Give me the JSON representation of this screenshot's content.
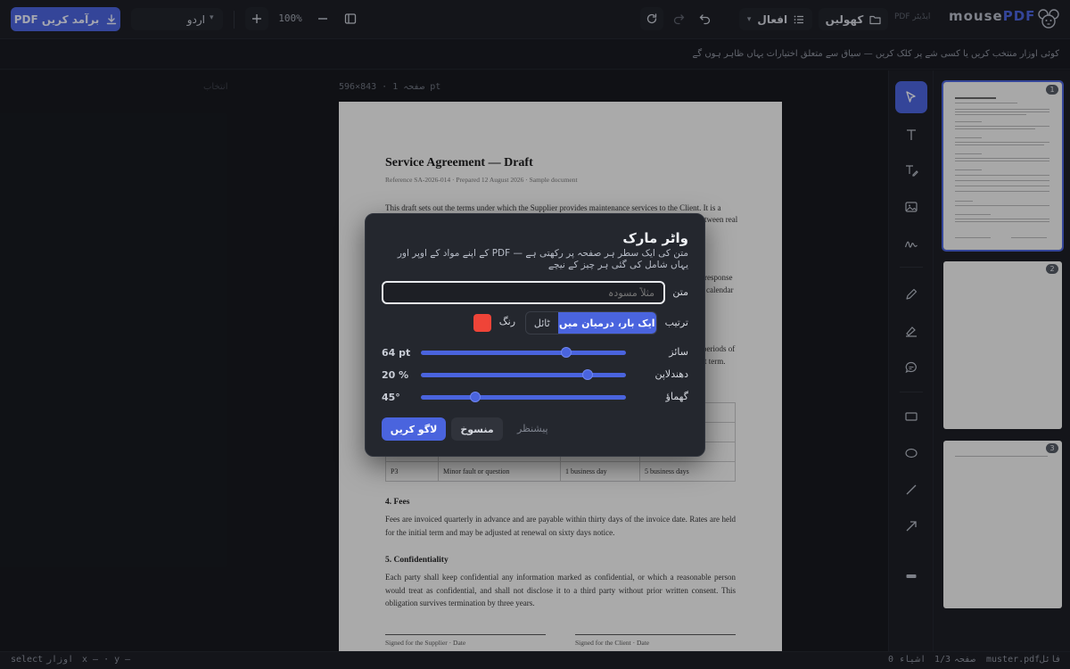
{
  "toolbar": {
    "export_label": "PDF برآمد کریں",
    "language": "اردو",
    "zoom": "100%",
    "actions_label": "افعال",
    "open_label": "کھولیں",
    "version": "PDF ایڈیٹر",
    "brand_a": "mouse",
    "brand_b": "PDF"
  },
  "hint": "کوئی اوزار منتخب کریں یا کسی شے پر کلک کریں — سیاق سے متعلق اختیارات یہاں ظاہر ہوں گے",
  "canvas": {
    "filename_dim": "انتخاب",
    "page_info": "صفحہ 1 · 843×596 pt"
  },
  "document": {
    "title": "Service Agreement — Draft",
    "reference": "Reference SA-2026-014 · Prepared 12 August 2026 · Sample document",
    "intro": "This draft sets out the terms under which the Supplier provides maintenance services to the Client. It is a",
    "intro_tail": "tween real",
    "frag_response": "response",
    "frag_calendar": "calendar",
    "frag_periods": "periods of",
    "frag_term": "t term.",
    "sla_last_row": [
      "P3",
      "Minor fault or question",
      "1 business day",
      "5 business days"
    ],
    "fees_heading": "4. Fees",
    "fees_text": "Fees are invoiced quarterly in advance and are payable within thirty days of the invoice date. Rates are held for the initial term and may be adjusted at renewal on sixty days notice.",
    "conf_heading": "5. Confidentiality",
    "conf_text": "Each party shall keep confidential any information marked as confidential, or which a reasonable person would treat as confidential, and shall not disclose it to a third party without prior written consent. This obligation survives termination by three years.",
    "sign_supplier": "Signed for the Supplier · Date",
    "sign_client": "Signed for the Client · Date"
  },
  "thumbnails": [
    {
      "page": "1",
      "selected": true
    },
    {
      "page": "2",
      "selected": false
    },
    {
      "page": "3",
      "selected": false
    }
  ],
  "status": {
    "file_label": "فائل",
    "file": "muster.pdf",
    "page_label": "صفحہ",
    "page": "1/3",
    "objects_label": "اشیاء",
    "objects": "0",
    "tool_label": "اوزار",
    "tool": "select",
    "coords": "x — · y —"
  },
  "watermark_dialog": {
    "title": "واٹر مارک",
    "description": "متن کی ایک سطر ہر صفحہ پر رکھتی ہے — PDF کے اپنے مواد کے اوپر اور یہاں شامل کی گئی ہر چیز کے نیچے",
    "text_label": "متن",
    "text_placeholder": "مثلاً مسودہ",
    "layout_label": "ترتیب",
    "layout_options": [
      "ایک بار، درمیان میں",
      "ٹائل"
    ],
    "layout_selected": "ایک بار، درمیان میں",
    "color_label": "رنگ",
    "color": "#ef4438",
    "size_label": "سائز",
    "size_value": "64 pt",
    "size_level": 0.72,
    "opacity_label": "دھندلاپن",
    "opacity_value": "20 %",
    "opacity_level": 0.83,
    "rotation_label": "گھماؤ",
    "rotation_value": "45°",
    "rotation_level": 0.25,
    "apply_label": "لاگو کریں",
    "cancel_label": "منسوخ",
    "preview_label": "پیشنظر"
  },
  "colors": {
    "accent": "#4a64de",
    "background": "#17191e",
    "panel": "#24272e"
  }
}
